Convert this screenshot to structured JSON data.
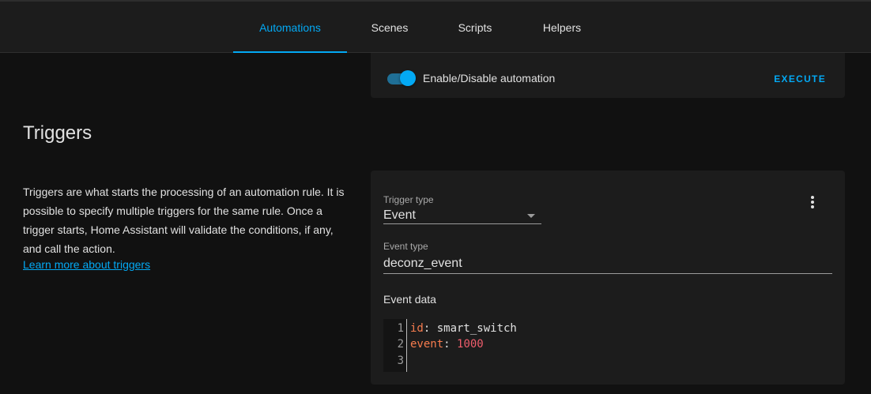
{
  "tabs": [
    {
      "label": "Automations",
      "active": true
    },
    {
      "label": "Scenes",
      "active": false
    },
    {
      "label": "Scripts",
      "active": false
    },
    {
      "label": "Helpers",
      "active": false
    }
  ],
  "automation_card": {
    "toggle_label": "Enable/Disable automation",
    "toggle_on": true,
    "execute_label": "EXECUTE"
  },
  "triggers_section": {
    "title": "Triggers",
    "description": "Triggers are what starts the processing of an automation rule. It is possible to specify multiple triggers for the same rule. Once a trigger starts, Home Assistant will validate the conditions, if any, and call the action.",
    "link_text": "Learn more about triggers"
  },
  "trigger_card": {
    "trigger_type_label": "Trigger type",
    "trigger_type_value": "Event",
    "event_type_label": "Event type",
    "event_type_value": "deconz_event",
    "event_data_label": "Event data",
    "menu_icon": "dots-vertical-icon"
  },
  "code_editor": {
    "line_numbers": [
      "1",
      "2",
      "3"
    ],
    "lines": [
      {
        "key": "id",
        "sep": ": ",
        "value": "smart_switch",
        "value_type": "string"
      },
      {
        "key": "event",
        "sep": ": ",
        "value": "1000",
        "value_type": "number"
      },
      {
        "key": "",
        "sep": "",
        "value": "",
        "value_type": "empty"
      }
    ]
  },
  "colors": {
    "accent": "#03a9f4",
    "background": "#111111",
    "card": "#1c1c1c",
    "yaml_key": "#f77c4e",
    "yaml_number": "#ef5d6c"
  }
}
